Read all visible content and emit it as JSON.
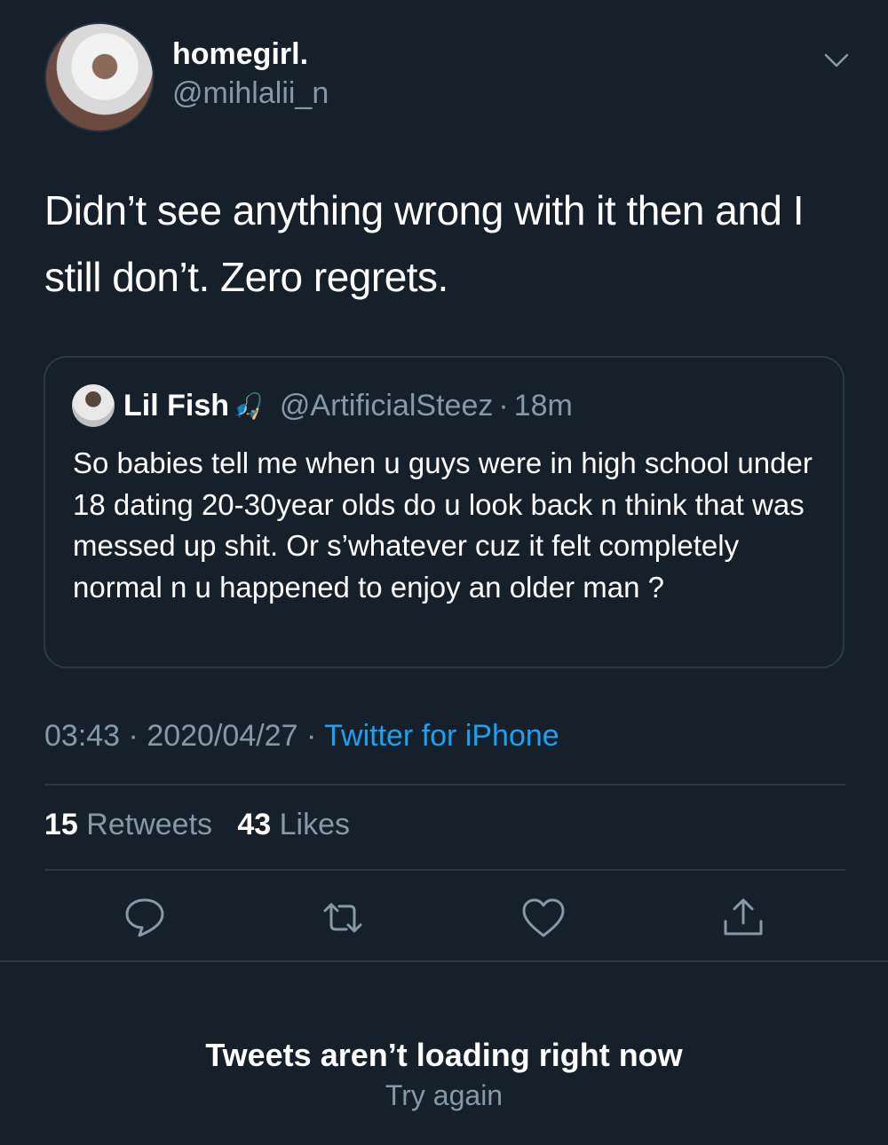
{
  "author": {
    "display_name": "homegirl.",
    "handle": "@mihlalii_n"
  },
  "tweet": {
    "text": "Didn’t see anything wrong with it then and I still don’t. Zero regrets."
  },
  "quoted": {
    "name": "Lil Fish",
    "emoji": "🎣",
    "handle": "@ArtificialSteez",
    "separator": "·",
    "time": "18m",
    "text": "So babies tell me when u guys were in high school under 18 dating 20-30year olds do u look back n think that was messed up shit. Or s’whatever cuz it felt completely normal n u happened to enjoy an older man ?"
  },
  "meta": {
    "time": "03:43",
    "date": "2020/04/27",
    "sep": "·",
    "source": "Twitter for iPhone"
  },
  "stats": {
    "retweets_count": "15",
    "retweets_label": "Retweets",
    "likes_count": "43",
    "likes_label": "Likes"
  },
  "icons": {
    "menu": "chevron-down-icon",
    "reply": "reply-icon",
    "retweet": "retweet-icon",
    "like": "heart-icon",
    "share": "share-icon"
  },
  "colors": {
    "background": "#15202b",
    "accent": "#1da1f2",
    "secondary_text": "#8899a6"
  },
  "error": {
    "title": "Tweets aren’t loading right now",
    "retry": "Try again"
  }
}
